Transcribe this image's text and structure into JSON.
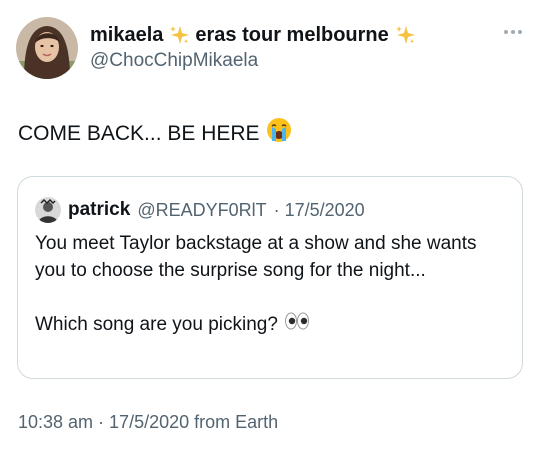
{
  "tweet": {
    "author_name": "mikaela",
    "author_name_suffix": "eras tour melbourne",
    "author_handle": "@ChocChipMikaela",
    "text": "COME BACK... BE HERE",
    "text_emoji": "crying-face-emoji",
    "timestamp": "10:38 am · 17/5/2020 from Earth"
  },
  "quoted": {
    "author_name": "patrick",
    "author_handle": "@READYF0RlT",
    "date": "· 17/5/2020",
    "line1": "You meet Taylor backstage at a show and she wants you to choose the surprise song for the night...",
    "line2": "Which song are you picking?",
    "line2_emoji": "eyes-emoji"
  },
  "colors": {
    "text": "#0f1419",
    "muted": "#536471",
    "border": "#cfd9de",
    "sparkle": "#f5c242"
  }
}
